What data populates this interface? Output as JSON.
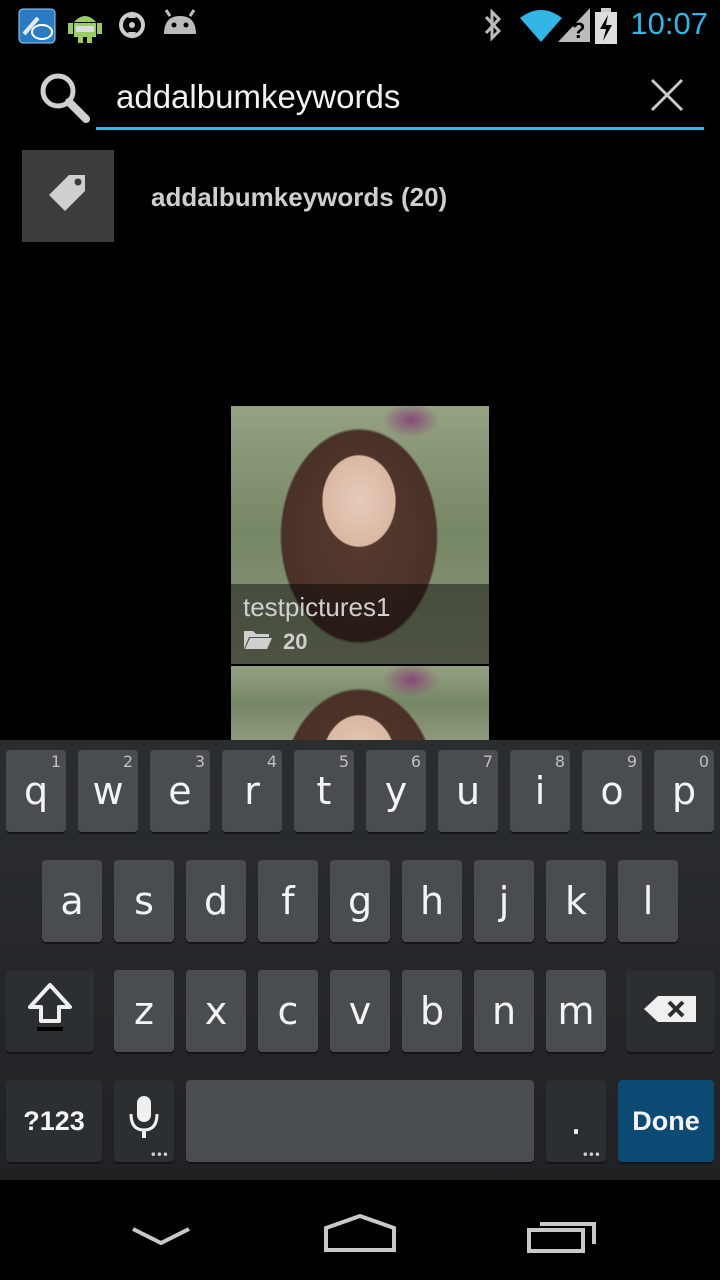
{
  "status_bar": {
    "time": "10:07",
    "left_icons": [
      "intel-app-icon",
      "android-debug-icon",
      "sync-icon",
      "android-icon"
    ],
    "right_icons": [
      "bluetooth-icon",
      "wifi-icon",
      "signal-unknown-icon",
      "battery-charging-icon"
    ],
    "time_color": "#33b5e5"
  },
  "search": {
    "query": "addalbumkeywords",
    "accent": "#33b5e5"
  },
  "suggestion": {
    "label": "addalbumkeywords (20)"
  },
  "albums": [
    {
      "name": "testpictures1",
      "count": "20"
    }
  ],
  "keyboard": {
    "row1": [
      {
        "k": "q",
        "h": "1"
      },
      {
        "k": "w",
        "h": "2"
      },
      {
        "k": "e",
        "h": "3"
      },
      {
        "k": "r",
        "h": "4"
      },
      {
        "k": "t",
        "h": "5"
      },
      {
        "k": "y",
        "h": "6"
      },
      {
        "k": "u",
        "h": "7"
      },
      {
        "k": "i",
        "h": "8"
      },
      {
        "k": "o",
        "h": "9"
      },
      {
        "k": "p",
        "h": "0"
      }
    ],
    "row2": [
      "a",
      "s",
      "d",
      "f",
      "g",
      "h",
      "j",
      "k",
      "l"
    ],
    "row3": [
      "z",
      "x",
      "c",
      "v",
      "b",
      "n",
      "m"
    ],
    "sym_label": "?123",
    "period_label": ".",
    "done_label": "Done",
    "done_color": "#0c4a73"
  }
}
